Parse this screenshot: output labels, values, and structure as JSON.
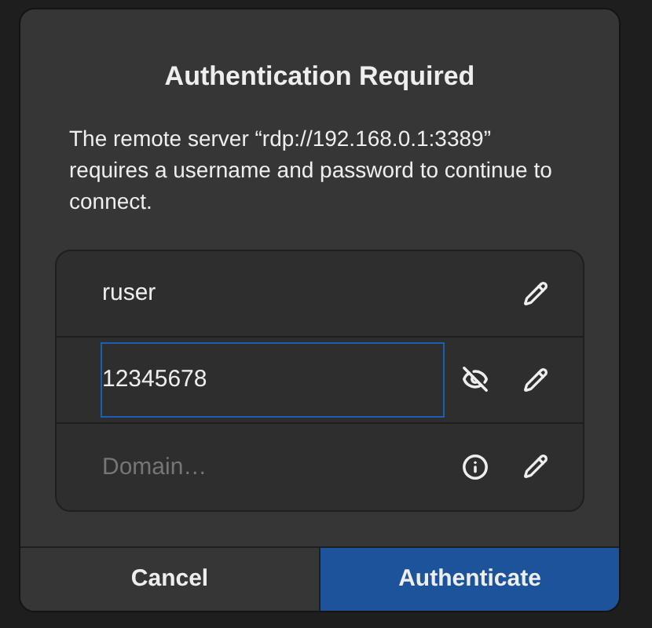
{
  "dialog": {
    "title": "Authentication Required",
    "body": "The remote server “rdp://192.168.0.1:3389” requires a username and password to continue to connect."
  },
  "fields": [
    {
      "kind": "text",
      "value": "ruser",
      "focused": false
    },
    {
      "kind": "password",
      "value": "12345678",
      "focused": true
    },
    {
      "kind": "domain",
      "placeholder": "Domain…",
      "focused": false
    }
  ],
  "buttons": [
    {
      "label": "Cancel",
      "kind": "plain"
    },
    {
      "label": "Authenticate",
      "kind": "suggested"
    }
  ]
}
